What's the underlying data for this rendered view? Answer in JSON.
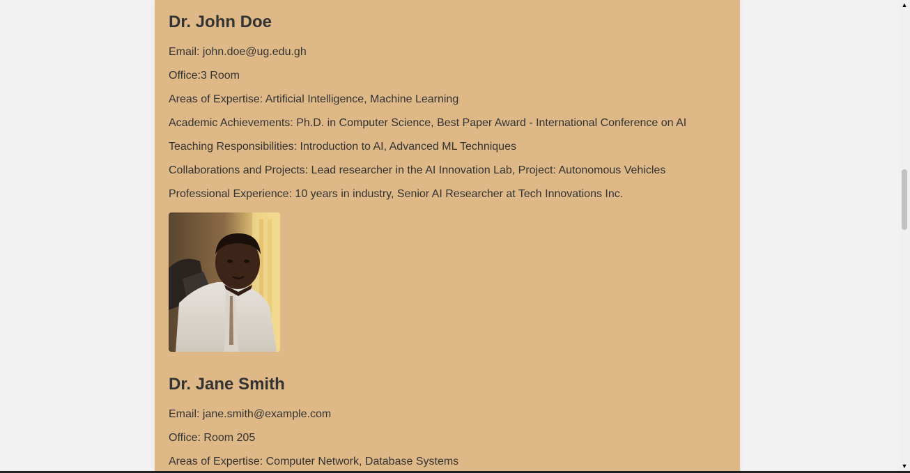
{
  "profiles": [
    {
      "name": "Dr. John Doe",
      "email": "Email: john.doe@ug.edu.gh",
      "office": "Office:3 Room",
      "expertise": "Areas of Expertise: Artificial Intelligence, Machine Learning",
      "achievements": "Academic Achievements: Ph.D. in Computer Science, Best Paper Award - International Conference on AI",
      "teaching": "Teaching Responsibilities: Introduction to AI, Advanced ML Techniques",
      "collaborations": "Collaborations and Projects: Lead researcher in the AI Innovation Lab, Project: Autonomous Vehicles",
      "experience": "Professional Experience: 10 years in industry, Senior AI Researcher at Tech Innovations Inc."
    },
    {
      "name": "Dr. Jane Smith",
      "email": "Email: jane.smith@example.com",
      "office": "Office: Room 205",
      "expertise": "Areas of Expertise: Computer Network, Database Systems"
    }
  ],
  "colors": {
    "card_background": "#deb887",
    "page_background": "#f2f2f3",
    "text": "#333333"
  }
}
